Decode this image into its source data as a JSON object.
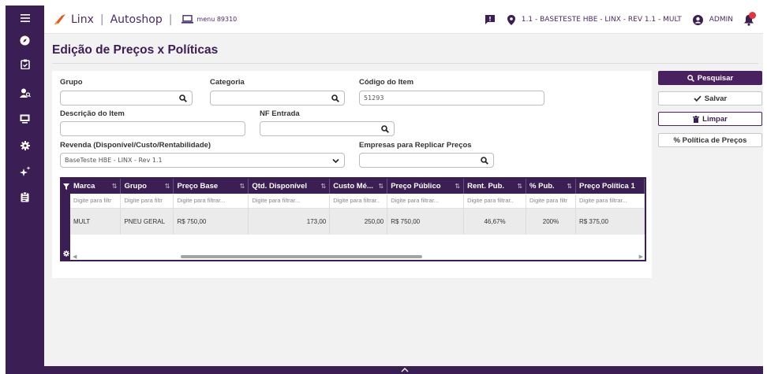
{
  "topbar": {
    "brand": "Linx",
    "app": "Autoshop",
    "menu": "menu 89310",
    "context": "1.1 - BASETESTE HBE - LINX - REV 1.1 - MULT",
    "user": "ADMIN"
  },
  "page": {
    "title": "Edição de Preços x Políticas"
  },
  "form": {
    "grupo_label": "Grupo",
    "grupo_value": "",
    "categoria_label": "Categoria",
    "categoria_value": "",
    "codigo_label": "Código do Item",
    "codigo_value": "51293",
    "descricao_label": "Descrição do Item",
    "descricao_value": "",
    "nf_label": "NF Entrada",
    "nf_value": "",
    "revenda_label": "Revenda (Disponível/Custo/Rentabilidade)",
    "revenda_value": "BaseTeste HBE - LINX - Rev 1.1",
    "empresas_label": "Empresas para Replicar Preços",
    "empresas_value": ""
  },
  "actions": {
    "pesquisar": "Pesquisar",
    "salvar": "Salvar",
    "limpar": "Limpar",
    "politica": "% Política de Preços"
  },
  "grid": {
    "columns": [
      "Marca",
      "Grupo",
      "Preço Base",
      "Qtd. Disponível",
      "Custo Mé...",
      "Preço Público",
      "Rent. Pub.",
      "% Pub.",
      "Preço Política 1"
    ],
    "filters": [
      "Digite para filtr",
      "Digite para filtr",
      "Digite para filtrar...",
      "Digite para filtrar...",
      "Digite para filtrar..",
      "Digite para filtrar...",
      "Digite para filtrar..",
      "Digite para filtr",
      "Digite para filtrar..."
    ],
    "rows": [
      [
        "MULT",
        "PNEU GERAL",
        "R$ 750,00",
        "173,00",
        "250,00",
        "R$ 750,00",
        "46,67%",
        "200%",
        "R$ 375,00"
      ]
    ]
  },
  "colors": {
    "primary": "#3b1e54",
    "button": "#4a2160",
    "accent": "#e8551e"
  }
}
